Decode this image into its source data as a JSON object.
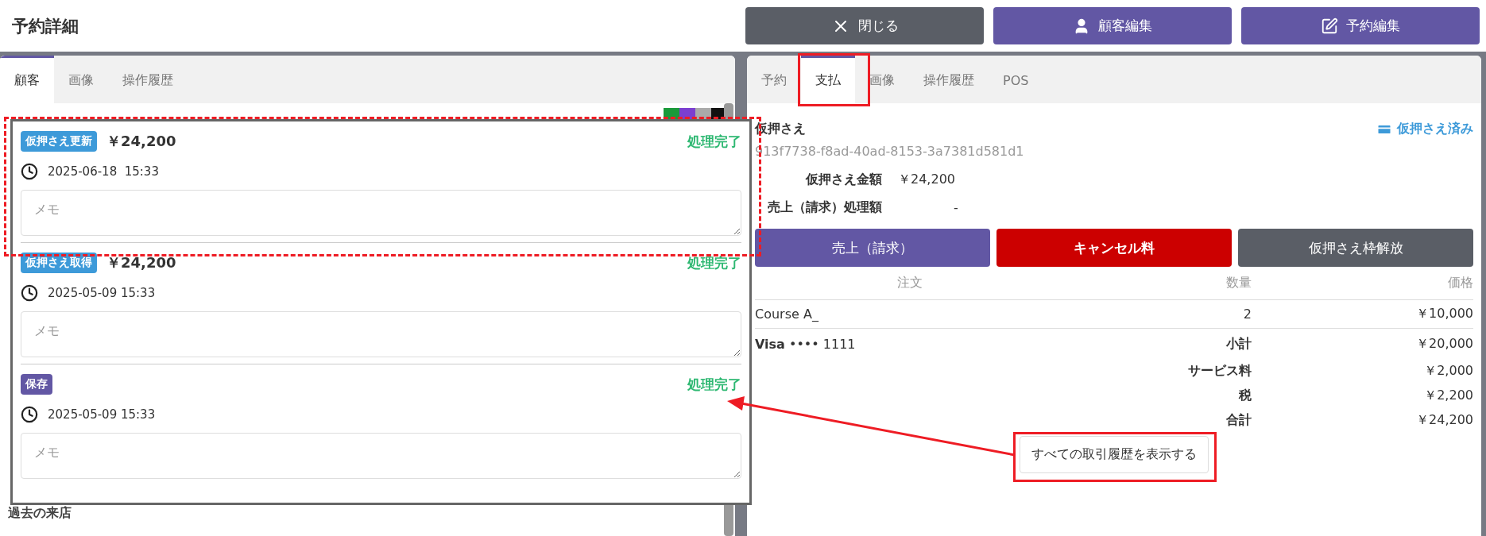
{
  "page_title": "予約詳細",
  "header_buttons": [
    {
      "kind": "close",
      "label": "閉じる"
    },
    {
      "kind": "customer",
      "label": "顧客編集"
    },
    {
      "kind": "edit",
      "label": "予約編集"
    }
  ],
  "left_panel": {
    "tabs": [
      {
        "label": "顧客",
        "selected": true
      },
      {
        "label": "画像",
        "selected": false
      },
      {
        "label": "操作履歴",
        "selected": false
      }
    ],
    "section_label": "過去の来店"
  },
  "right_panel": {
    "tabs": [
      {
        "label": "予約",
        "selected": false
      },
      {
        "label": "支払",
        "selected": true
      },
      {
        "label": "画像",
        "selected": false
      },
      {
        "label": "操作履歴",
        "selected": false
      },
      {
        "label": "POS",
        "selected": false
      }
    ],
    "hold": {
      "title": "仮押さえ",
      "status": "仮押さえ済み",
      "id": "913f7738-f8ad-40ad-8153-3a7381d581d1",
      "amount_label": "仮押さえ金額",
      "amount": "￥24,200",
      "processed_label": "売上（請求）処理額",
      "processed": "-"
    },
    "actions": [
      {
        "kind": "primary",
        "label": "売上（請求）"
      },
      {
        "kind": "danger",
        "label": "キャンセル料"
      },
      {
        "kind": "secondary",
        "label": "仮押さえ枠解放"
      }
    ],
    "table": {
      "columns": [
        "注文",
        "数量",
        "価格"
      ],
      "rows": [
        [
          "Course A_",
          "2",
          "￥10,000"
        ]
      ]
    },
    "payment_method": "**Visa** •••• 1111",
    "summary": [
      {
        "label": "小計",
        "value": "￥20,000"
      },
      {
        "label": "サービス料",
        "value": "￥2,000"
      },
      {
        "label": "税",
        "value": "￥2,200"
      },
      {
        "label": "合計",
        "value": "￥24,200"
      }
    ],
    "history_button": "すべての取引履歴を表示する"
  },
  "history_popup": {
    "entries": [
      {
        "type": "仮押さえ更新",
        "color": "#3d9ad9",
        "amount": "￥24,200",
        "status": "処理完了",
        "time": "2025-06-18  15:33",
        "memo_placeholder": "メモ"
      },
      {
        "type": "仮押さえ取得",
        "color": "#3d9ad9",
        "amount": "￥24,200",
        "status": "処理完了",
        "time": "2025-05-09 15:33",
        "memo_placeholder": "メモ"
      },
      {
        "type": "保存",
        "color": "#6257a4",
        "status": "処理完了",
        "time": "2025-05-09 15:33",
        "memo_placeholder": "メモ"
      }
    ]
  }
}
